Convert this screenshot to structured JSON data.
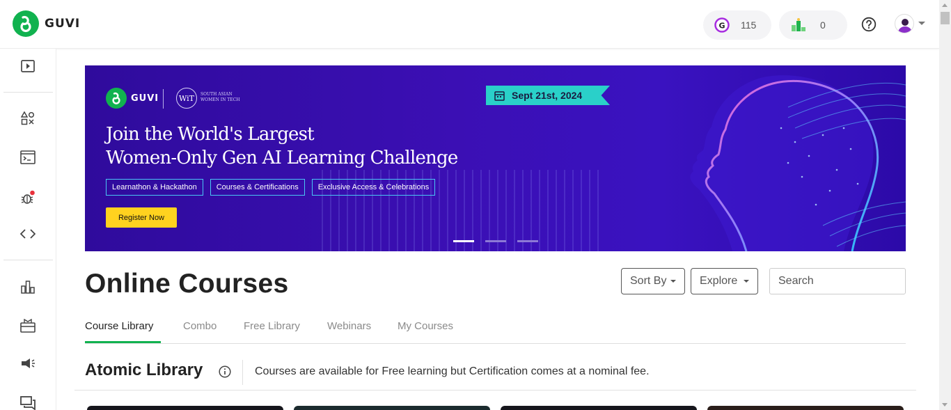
{
  "app": {
    "brand": "GUVI",
    "brand_color": "#11b24f"
  },
  "header": {
    "gems_icon": "g-coin-icon",
    "gems_count": "115",
    "rank_icon": "leaderboard-podium-icon",
    "rank_count": "0",
    "help_icon": "question-circle-icon",
    "avatar_icon": "user-avatar-icon"
  },
  "sidebar": {
    "items": [
      {
        "name": "video-play-icon"
      },
      {
        "name": "shapes-icon"
      },
      {
        "name": "terminal-window-icon"
      },
      {
        "name": "bug-icon",
        "badge": true
      },
      {
        "name": "code-brackets-icon"
      },
      {
        "name": "bar-chart-icon"
      },
      {
        "name": "gift-box-icon"
      },
      {
        "name": "megaphone-icon"
      },
      {
        "name": "chat-bubbles-icon"
      }
    ]
  },
  "banner": {
    "logo_text": "GUVI",
    "wit_mark": "WiT",
    "wit_text": "SOUTH ASIAN WOMEN IN TECH",
    "date": "Sept 21st, 2024",
    "headline_line1": "Join the World's Largest",
    "headline_line2": "Women-Only Gen AI Learning Challenge",
    "tags": [
      "Learnathon & Hackathon",
      "Courses & Certifications",
      "Exclusive Access & Celebrations"
    ],
    "cta": "Register Now",
    "slides": 3,
    "active_slide": 0,
    "colors": {
      "bg": "#3b0fb4",
      "date_bg": "#2ad0c9",
      "cta_bg": "#ffd21f",
      "tag_border": "#49c7f4"
    }
  },
  "main": {
    "title": "Online Courses",
    "sort_label": "Sort By",
    "explore_label": "Explore",
    "search_placeholder": "Search",
    "tabs": [
      "Course Library",
      "Combo",
      "Free Library",
      "Webinars",
      "My Courses"
    ],
    "active_tab": 0,
    "section_title": "Atomic Library",
    "section_note": "Courses are available for Free learning but Certification comes at a nominal fee."
  }
}
